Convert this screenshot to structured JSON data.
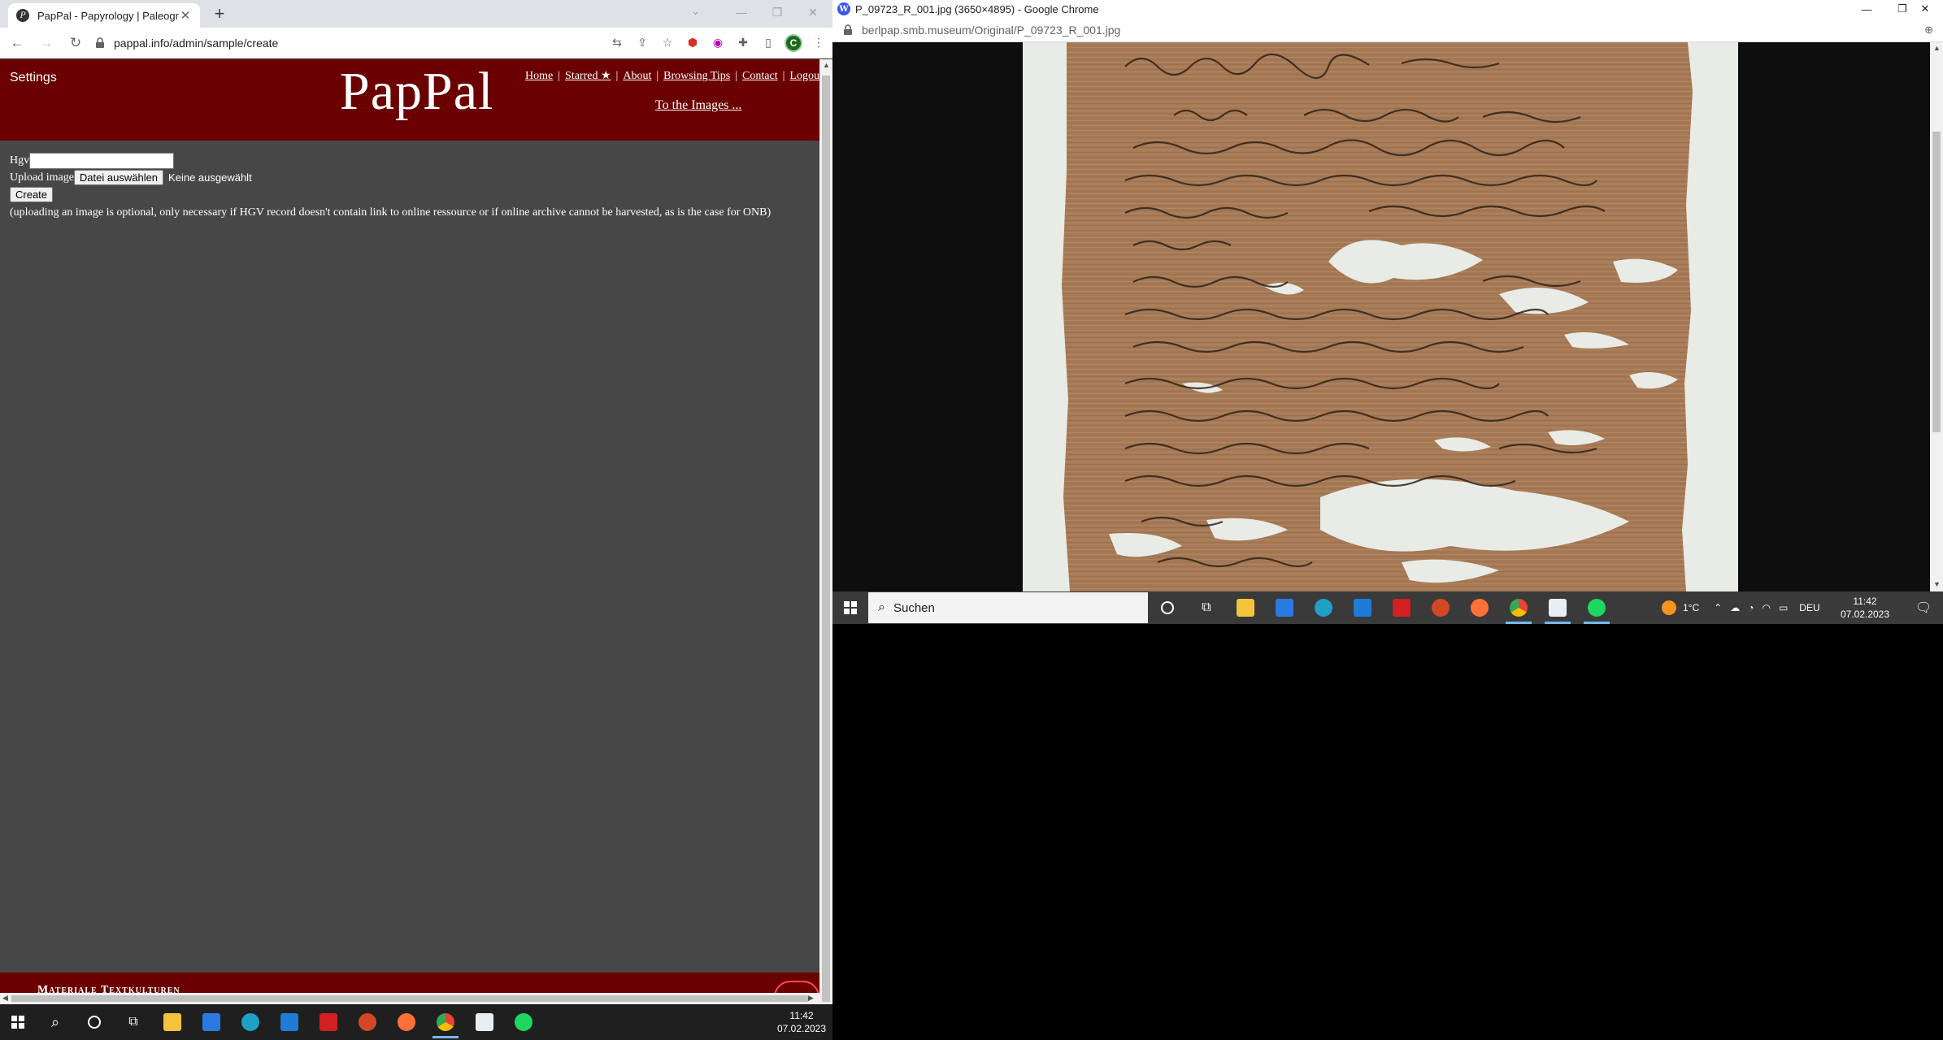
{
  "left_browser": {
    "tab_title": "PapPal - Papyrology | Paleograph",
    "tab_favicon": "pappal-icon",
    "url": "pappal.info/admin/sample/create",
    "profile_initial": "C"
  },
  "site": {
    "settings_label": "Settings",
    "logo": "PapPal",
    "nav": [
      "Home",
      "Starred ★",
      "About",
      "Browsing Tips",
      "Contact",
      "Logout"
    ],
    "to_images": "To the Images ...",
    "footer_text": "Materiale Textkulturen",
    "colors": {
      "header_bg": "#6b0000",
      "page_bg": "#474747"
    }
  },
  "form": {
    "hgv_label": "Hgv",
    "hgv_value": "",
    "upload_label": "Upload image",
    "file_button": "Datei auswählen",
    "no_file_text": "Keine ausgewählt",
    "create_button": "Create",
    "note": "(uploading an image is optional, only necessary if HGV record doesn't contain link to online ressource or if online archive cannot be harvested, as is the case for ONB)"
  },
  "right_browser": {
    "window_title": "P_09723_R_001.jpg (3650×4895) - Google Chrome",
    "url": "berlpap.smb.museum/Original/P_09723_R_001.jpg"
  },
  "right_taskbar": {
    "search_placeholder": "Suchen",
    "weather": "1°C",
    "language": "DEU",
    "time": "11:42",
    "date": "07.02.2023"
  },
  "bottom_taskbar": {
    "time": "11:42",
    "date": "07.02.2023"
  }
}
